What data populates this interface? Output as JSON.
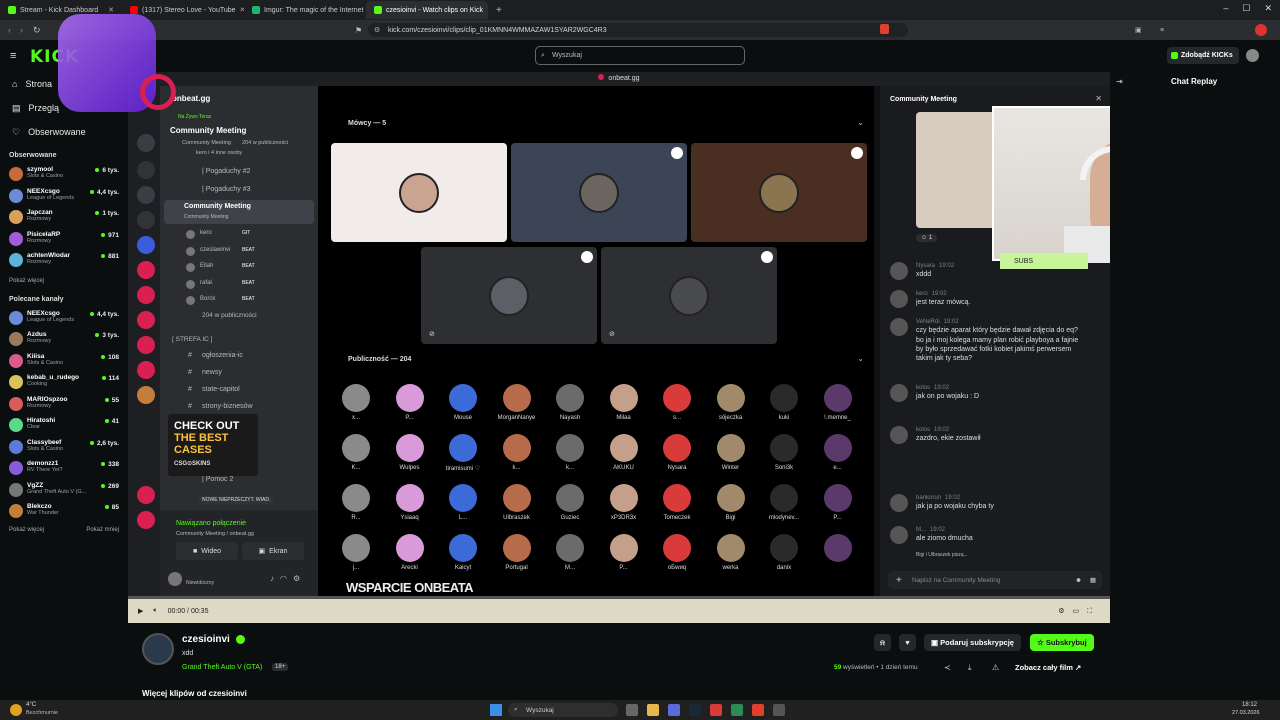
{
  "browser": {
    "tabs": [
      {
        "label": "Stream - Kick Dashboard",
        "color": "#53fc18"
      },
      {
        "label": "(1317) Stereo Love - YouTube",
        "color": "#ff0000"
      },
      {
        "label": "Imgur: The magic of the Internet",
        "color": "#1bb76e"
      },
      {
        "label": "czesioinvi - Watch clips on Kick",
        "color": "#53fc18",
        "active": true
      }
    ],
    "url": "kick.com/czesioinvi/clips/clip_01KMNN4WMMAZAW1SYAR2WGC4R3"
  },
  "kick": {
    "logo": "KICK",
    "search_placeholder": "Wyszukaj",
    "kicks_button": "Zdobądź KICKs",
    "nav": [
      {
        "label": "Strona"
      },
      {
        "label": "Przeglą"
      },
      {
        "label": "Obserwowane"
      }
    ],
    "followed_header": "Obserwowane",
    "followed": [
      {
        "name": "szymool",
        "cat": "Slots & Casino",
        "viewers": "6 tys.",
        "color": "#c86b3a"
      },
      {
        "name": "NEEXcsgo",
        "cat": "League of Legends",
        "viewers": "4,4 tys.",
        "color": "#6b8bd6"
      },
      {
        "name": "Japczan",
        "cat": "Rozmowy",
        "viewers": "1 tys.",
        "color": "#d9a05b"
      },
      {
        "name": "PisicelaRP",
        "cat": "Rozmowy",
        "viewers": "971",
        "color": "#a35bd9"
      },
      {
        "name": "achtenWlodar",
        "cat": "Rozmowy",
        "viewers": "881",
        "color": "#5bb6d9"
      }
    ],
    "show_more": "Pokaż więcej",
    "recommended_header": "Polecane kanały",
    "recommended": [
      {
        "name": "NEEXcsgo",
        "cat": "League of Legends",
        "viewers": "4,4 tys.",
        "color": "#6b8bd6"
      },
      {
        "name": "Azdus",
        "cat": "Rozmowy",
        "viewers": "3 tys.",
        "color": "#9b7a5b"
      },
      {
        "name": "Kiiisa",
        "cat": "Slots & Casino",
        "viewers": "108",
        "color": "#d95b8a"
      },
      {
        "name": "kebab_u_rudego",
        "cat": "Cooking",
        "viewers": "114",
        "color": "#d9c45b"
      },
      {
        "name": "MARIOspzoo",
        "cat": "Rozmowy",
        "viewers": "55",
        "color": "#d95b5b"
      },
      {
        "name": "Hiratoshi",
        "cat": "Clear",
        "viewers": "41",
        "color": "#5bd98a"
      },
      {
        "name": "Classybeef",
        "cat": "Slots & Casino",
        "viewers": "2,6 tys.",
        "color": "#5b7ad9"
      },
      {
        "name": "demonzz1",
        "cat": "RV There Yet?",
        "viewers": "338",
        "color": "#8a5bd9"
      },
      {
        "name": "VgZZ",
        "cat": "Grand Theft Auto V (G...",
        "viewers": "269",
        "color": "#777"
      },
      {
        "name": "Blekczo",
        "cat": "War Thunder",
        "viewers": "85",
        "color": "#c47d3a"
      }
    ],
    "show_more_2": "Pokaż więcej",
    "show_less": "Pokaż mniej"
  },
  "discord": {
    "top_title": "onbeat.gg",
    "server_name": "onbeat.gg",
    "live_label": "Na Żywo Teraz",
    "live_event": "Community Meeting",
    "live_sub": "Community Meeting",
    "live_count": "204 w publiczności",
    "live_people": "kero i 4 inne osoby",
    "channels": [
      "| Pogaduchy #2",
      "| Pogaduchy #3",
      "Community Meeting"
    ],
    "stage_sub": "Community Meeting",
    "speakers_in_channel": [
      {
        "name": "kero",
        "tag": "GIT"
      },
      {
        "name": "czeslawinvi",
        "tag": "BEAT"
      },
      {
        "name": "Ellah",
        "tag": "BEAT"
      },
      {
        "name": "rafał.",
        "tag": "BEAT"
      },
      {
        "name": "Borck",
        "tag": "BEAT"
      }
    ],
    "audience_count_small": "204 w publiczności",
    "category": "[ STREFA IC ]",
    "text_channels": [
      "ogłoszenia-ic",
      "newsy",
      "state-capitol",
      "strony-biznesów"
    ],
    "pomoc": "| Pomoc 2",
    "new_unread": "NOWE NIEPRZECZYT. WIAD.",
    "connected": "Nawiązano połączenie",
    "connected_sub": "Community Meeting / onbeat.gg",
    "video_btn": "Wideo",
    "screen_btn": "Ekran",
    "user_status": "Niewidoczny",
    "speakers_header": "Mówcy — 5",
    "audience_header": "Publiczność — 204",
    "audience": [
      "x...",
      "P...",
      "Mouse",
      "MorganNanye",
      "Nayash",
      "Milaa",
      "s...",
      "sójeczka",
      "kuki",
      "!.memne_",
      "K...",
      "Wulpes",
      "tiramisumi ♡",
      "k...",
      "k...",
      "AKUKU",
      "Nysara",
      "Winter",
      "Soni3k",
      "e...",
      "R...",
      "Ysiaaq",
      "L...",
      "Ulbraszek",
      "Guziec",
      "xP3DR3x",
      "Tomeczek",
      "Bigi",
      "mlodynev...",
      "P...",
      "j...",
      "Arecki",
      "Kalcyt",
      "Portugal",
      "M...",
      "P...",
      "oБwиq",
      "werka",
      "danix",
      ""
    ],
    "community_title": "Community Meeting",
    "messages": [
      {
        "user": "Nysara",
        "time": "19:02",
        "text": "xddd"
      },
      {
        "user": "kero",
        "time": "19:02",
        "text": "jest teraz mówcą."
      },
      {
        "user": "VeNeRdi",
        "time": "19:02",
        "text": "czy będzie aparat który będzie dawał zdjęcia do eq? bo ja i moj kolega mamy plan robić playboya a fajnie by było sprzedawać fotki kobiet jakimś perwersem takim jak ty seba?"
      },
      {
        "user": "kolos",
        "time": "19:02",
        "text": "jak on po wojaku : D"
      },
      {
        "user": "kolos",
        "time": "19:02",
        "text": "zazdro, ekie zostawił"
      },
      {
        "user": "bankorun",
        "time": "19:02",
        "text": "jak ja po wojaku chyba ty"
      },
      {
        "user": "M...",
        "time": "19:02",
        "text": "ale ziomo dmucha"
      }
    ],
    "typing": "Bigi i Ulbraszek piszą...",
    "input_placeholder": "Napisz na Community Meeting",
    "reaction_count": "1"
  },
  "overlay": {
    "ad_line1": "CHECK OUT",
    "ad_line2": "THE BEST",
    "ad_line3": "CASES",
    "ad_brand": "CSG⊙SKINS",
    "banner": "WSPARCIE ONBEATA",
    "subs_label": "SUBS"
  },
  "player": {
    "time": "00:00 / 00:35",
    "progress": 0.0
  },
  "chat_replay": {
    "title": "Chat Replay"
  },
  "clip": {
    "channel": "czesioinvi",
    "title": "xdd",
    "game": "Grand Theft Auto V (GTA)",
    "age": "18+",
    "views": "59",
    "views_label": "wyświetleń • 1 dzień temu",
    "gift_btn": "Podaruj subskrypcję",
    "sub_btn": "Subskrybuj",
    "full_btn": "Zobacz cały film",
    "more_clips": "Więcej klipów od czesioinvi"
  },
  "taskbar": {
    "weather_temp": "4°C",
    "weather_desc": "Bezchmurnie",
    "search": "Wyszukaj",
    "time": "18:12",
    "date": "27.03.2026"
  }
}
